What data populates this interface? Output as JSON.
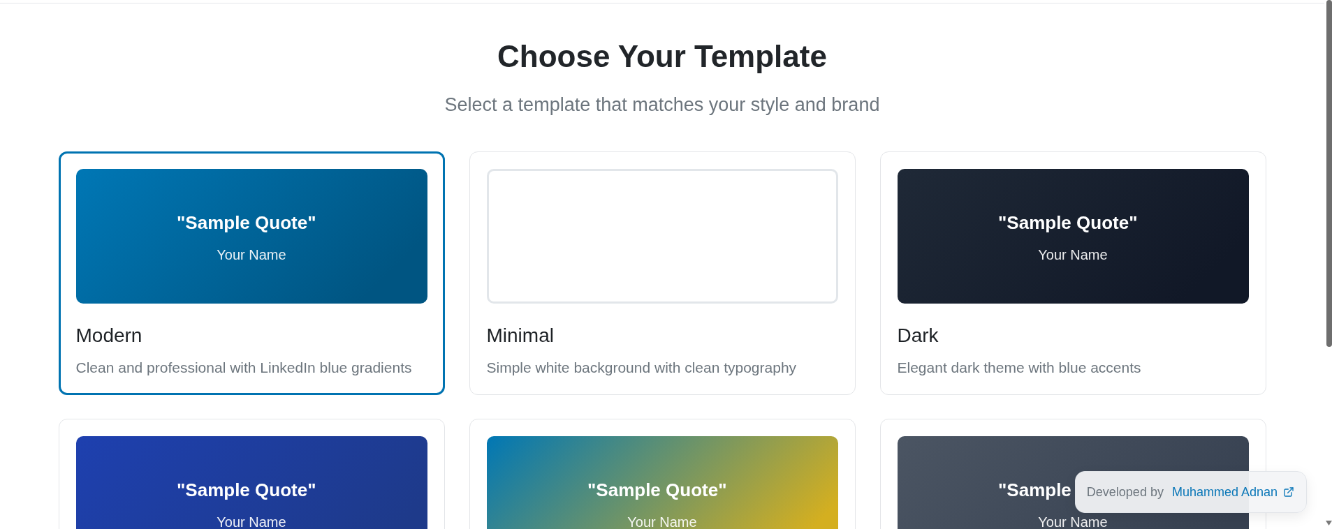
{
  "page": {
    "title": "Choose Your Template",
    "subtitle": "Select a template that matches your style and brand"
  },
  "templates": [
    {
      "kind": "gradient",
      "selected": true,
      "gradient": [
        {
          "color": "#0077b5"
        },
        {
          "color": "#005582"
        }
      ],
      "quote": "\"Sample Quote\"",
      "author": "Your Name",
      "name": "Modern",
      "description": "Clean and professional with LinkedIn blue gradients"
    },
    {
      "kind": "outline",
      "selected": false,
      "name": "Minimal",
      "description": "Simple white background with clean typography"
    },
    {
      "kind": "gradient",
      "selected": false,
      "gradient": [
        {
          "color": "#1f2937"
        },
        {
          "color": "#111827"
        }
      ],
      "quote": "\"Sample Quote\"",
      "author": "Your Name",
      "name": "Dark",
      "description": "Elegant dark theme with blue accents"
    },
    {
      "kind": "gradient",
      "selected": false,
      "gradient": [
        {
          "color": "#1e40af"
        },
        {
          "color": "#1e3a8a"
        }
      ],
      "quote": "\"Sample Quote\"",
      "author": "Your Name"
    },
    {
      "kind": "gradient",
      "selected": false,
      "gradient": [
        {
          "color": "#0077b5"
        },
        {
          "color": "#d4af20"
        }
      ],
      "quote": "\"Sample Quote\"",
      "author": "Your Name"
    },
    {
      "kind": "gradient",
      "selected": false,
      "gradient": [
        {
          "color": "#4b5563"
        },
        {
          "color": "#374151"
        }
      ],
      "quote": "\"Sample",
      "author": "Your Name"
    }
  ],
  "credit": {
    "label": "Developed by",
    "link": "Muhammed Adnan"
  }
}
